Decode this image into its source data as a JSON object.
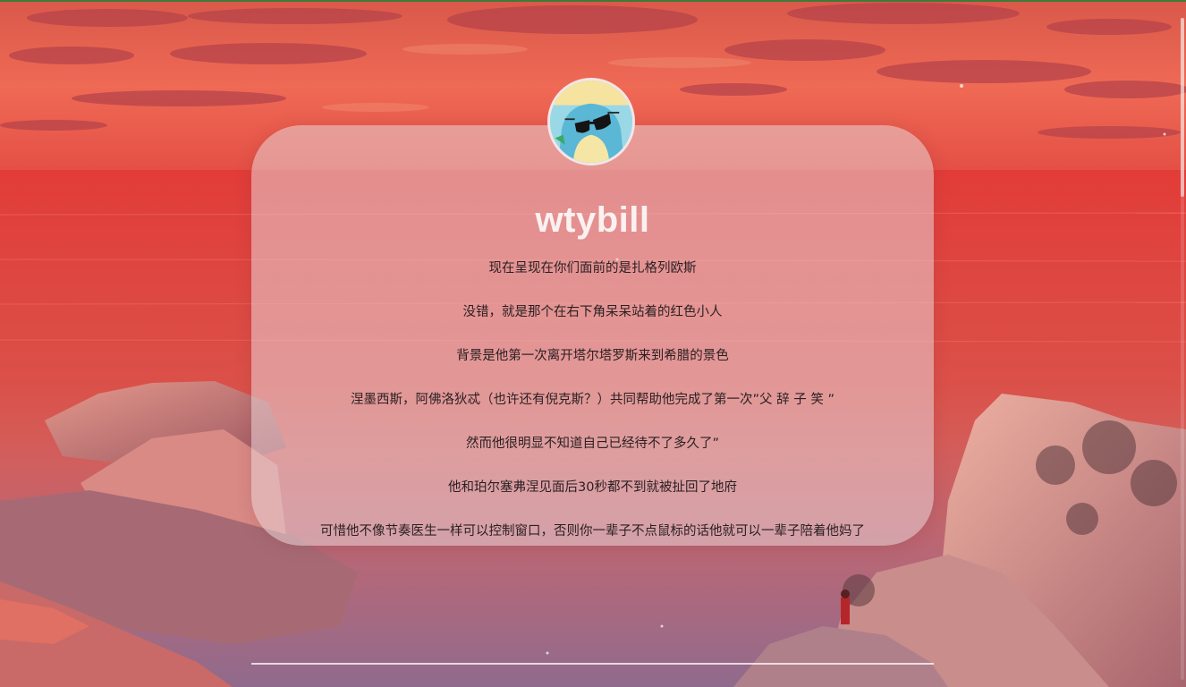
{
  "profile": {
    "username": "wtybill",
    "avatar_icon": "sunglasses-creature-avatar-icon"
  },
  "lines": [
    "现在呈现在你们面前的是扎格列欧斯",
    "没错，就是那个在右下角呆呆站着的红色小人",
    "背景是他第一次离开塔尔塔罗斯来到希腊的景色",
    "涅墨西斯，阿佛洛狄忒（也许还有倪克斯？）共同帮助他完成了第一次”父 辞 子 笑 ”",
    "然而他很明显不知道自己已经待不了多久了”",
    "他和珀尔塞弗涅见面后30秒都不到就被扯回了地府",
    "可惜他不像节奏医生一样可以控制窗口，否则你一辈子不点鼠标的话他就可以一辈子陪着他妈了"
  ],
  "colors": {
    "sky": "#e8574e",
    "sea": "#e0443d",
    "card": "#e8d2d6",
    "title": "#fbf1f1",
    "text": "#2a1f22"
  }
}
